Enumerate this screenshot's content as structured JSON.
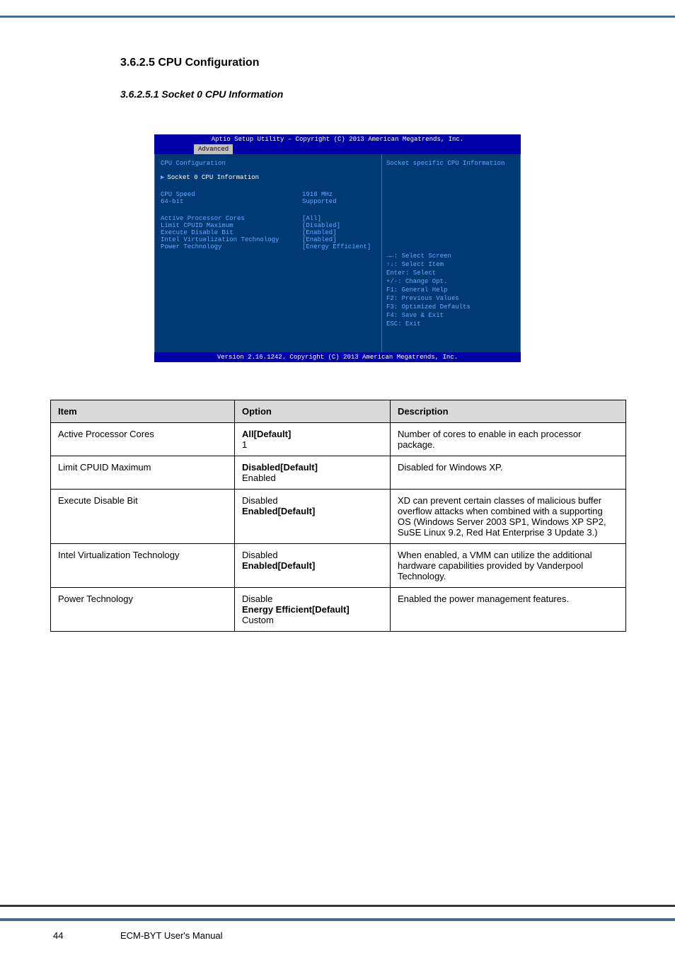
{
  "section_title": "3.6.2.5 CPU Configuration",
  "subsection_title": "3.6.2.5.1 Socket 0 CPU Information",
  "bios": {
    "title": "Aptio Setup Utility – Copyright (C) 2013 American Megatrends, Inc.",
    "tab": "Advanced",
    "heading": "CPU Configuration",
    "selected": "Socket 0 CPU Information",
    "rows": [
      {
        "label": "CPU Speed",
        "val": "1918 MHz"
      },
      {
        "label": "64-bit",
        "val": "Supported"
      }
    ],
    "opts": [
      {
        "label": "Active Processor Cores",
        "val": "[All]"
      },
      {
        "label": "Limit CPUID Maximum",
        "val": "[Disabled]"
      },
      {
        "label": "Execute Disable Bit",
        "val": "[Enabled]"
      },
      {
        "label": "Intel Virtualization Technology",
        "val": "[Enabled]"
      },
      {
        "label": "Power Technology",
        "val": "[Energy Efficient]"
      }
    ],
    "desc": "Socket specific CPU Information",
    "hints": [
      "→←: Select Screen",
      "↑↓: Select Item",
      "Enter: Select",
      "+/-: Change Opt.",
      "F1: General Help",
      "F2: Previous Values",
      "F3: Optimized Defaults",
      "F4: Save & Exit",
      "ESC: Exit"
    ],
    "footer": "Version 2.16.1242. Copyright (C) 2013 American Megatrends, Inc."
  },
  "table": {
    "headers": [
      "Item",
      "Option",
      "Description"
    ],
    "rows": [
      {
        "item": "Active Processor Cores",
        "options": [
          "All[Default]",
          "1"
        ],
        "defaults": [
          true,
          false
        ],
        "desc": "Number of cores to enable in each processor package."
      },
      {
        "item": "Limit CPUID Maximum",
        "options": [
          "Disabled[Default]",
          "Enabled"
        ],
        "defaults": [
          true,
          false
        ],
        "desc": "Disabled for Windows XP."
      },
      {
        "item": "Execute Disable Bit",
        "options": [
          "Disabled",
          "Enabled[Default]"
        ],
        "defaults": [
          false,
          true
        ],
        "desc": "XD can prevent certain classes of malicious buffer overflow attacks when combined with a supporting OS (Windows Server 2003 SP1, Windows XP SP2, SuSE Linux 9.2, Red Hat Enterprise 3 Update 3.)"
      },
      {
        "item": "Intel Virtualization Technology",
        "options": [
          "Disabled",
          "Enabled[Default]"
        ],
        "defaults": [
          false,
          true
        ],
        "desc": "When enabled, a VMM can utilize the additional hardware capabilities provided by Vanderpool Technology."
      },
      {
        "item": "Power Technology",
        "options": [
          "Disable",
          "Energy Efficient[Default]",
          "Custom"
        ],
        "defaults": [
          false,
          true,
          false
        ],
        "desc": "Enabled the power management features."
      }
    ]
  },
  "page_num": "44",
  "footer_text": "ECM-BYT User's Manual"
}
